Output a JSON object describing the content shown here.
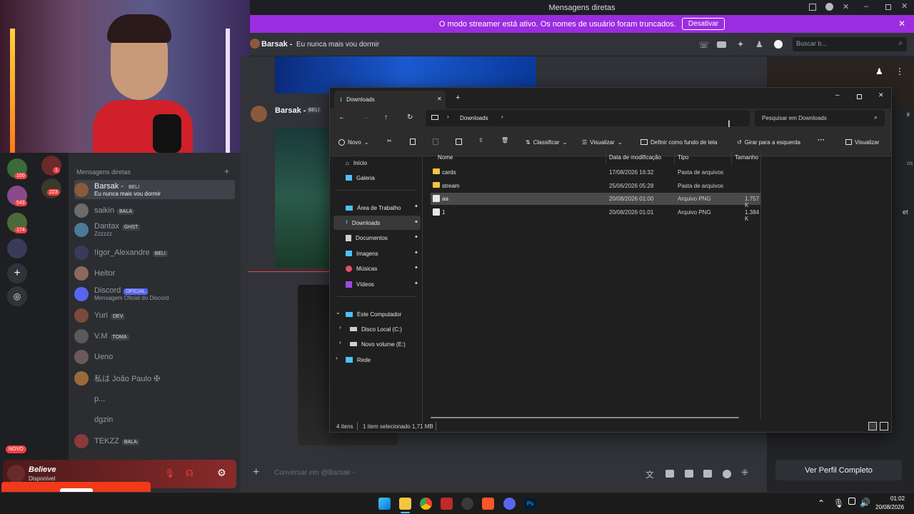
{
  "window": {
    "title": "Mensagens diretas"
  },
  "banner": {
    "text": "O modo streamer está ativo. Os nomes de usuário foram truncados.",
    "button": "Desativar"
  },
  "chat_header": {
    "name": "Barsak -",
    "status": "Eu nunca mais vou dormir",
    "search_placeholder": "Buscar b..."
  },
  "message": {
    "author": "Barsak -",
    "tag": "BELI"
  },
  "composer": {
    "placeholder": "Conversar em @Barsak -"
  },
  "profile": {
    "button": "Ver Perfil Completo",
    "partial_1": "ir",
    "partial_2": "os",
    "partial_3": "et"
  },
  "dm_list": {
    "header": "Mensagens diretas",
    "items": [
      {
        "name": "Barsak -",
        "tag": "BELI",
        "sub": "Eu nunca mais vou dormir",
        "color": "#8a5a3a"
      },
      {
        "name": "saikin",
        "tag": "BALA",
        "sub": "",
        "color": "#6b6b6b"
      },
      {
        "name": "Dantax",
        "tag": "GHST",
        "sub": "Zzzzzz",
        "color": "#4a7a9a"
      },
      {
        "name": "!Igor_Alexandre",
        "tag": "BELI",
        "sub": "",
        "color": "#3a3a5a"
      },
      {
        "name": "Heitor",
        "tag": "",
        "sub": "",
        "color": "#8a6a5a"
      },
      {
        "name": "Discord",
        "tag": "OFICIAL",
        "sub": "Mensagem Oficial do Discord",
        "color": "#5865f2"
      },
      {
        "name": "Yuri",
        "tag": "DEV",
        "sub": "",
        "color": "#7a4a3a"
      },
      {
        "name": "V.M",
        "tag": "TOMA",
        "sub": "",
        "color": "#5a5a5a"
      },
      {
        "name": "Ueno",
        "tag": "",
        "sub": "",
        "color": "#6a5a5a"
      },
      {
        "name": "私は João Paulo ✠",
        "tag": "",
        "sub": "",
        "color": "#9a6a3a"
      },
      {
        "name": "p...",
        "tag": "",
        "sub": "",
        "color": "#2b2d31"
      },
      {
        "name": "dgzin",
        "tag": "",
        "sub": "",
        "color": "#2b2d31"
      },
      {
        "name": "TEKZZ",
        "tag": "BALA",
        "sub": "",
        "color": "#8a3a3a"
      }
    ]
  },
  "servers": {
    "badges": [
      "100",
      "543",
      "174",
      "1",
      "223"
    ],
    "novo": "NOVO"
  },
  "user_panel": {
    "name": "Believe",
    "status": "Disponível"
  },
  "explorer": {
    "tab_title": "Downloads",
    "breadcrumb": "Downloads",
    "search_placeholder": "Pesquisar em Downloads",
    "toolbar": {
      "new": "Novo",
      "sort": "Classificar",
      "view": "Visualizar",
      "set_wallpaper": "Definir como fundo de tela",
      "rotate": "Girar para a esquerda",
      "more": "···",
      "preview": "Visualizar"
    },
    "nav": [
      "Início",
      "Galeria",
      "Área de Trabalho",
      "Downloads",
      "Documentos",
      "Imagens",
      "Músicas",
      "Vídeos",
      "Este Computador",
      "Disco Local (C:)",
      "Novo volume (E:)",
      "Rede"
    ],
    "columns": [
      "Nome",
      "Data de modificação",
      "Tipo",
      "Tamanho"
    ],
    "files": [
      {
        "name": "cards",
        "date": "17/08/2026 16:32",
        "type": "Pasta de arquivos",
        "size": "",
        "kind": "folder",
        "selected": false
      },
      {
        "name": "stream",
        "date": "25/06/2026 05:28",
        "type": "Pasta de arquivos",
        "size": "",
        "kind": "folder",
        "selected": false
      },
      {
        "name": "aa",
        "date": "20/08/2026 01:00",
        "type": "Arquivo PNG",
        "size": "1.757 K",
        "kind": "png",
        "selected": true
      },
      {
        "name": "1",
        "date": "20/08/2026 01:01",
        "type": "Arquivo PNG",
        "size": "1.384 K",
        "kind": "png",
        "selected": false
      }
    ],
    "status": {
      "count": "4 itens",
      "selected": "1 item selecionado 1,71 MB"
    }
  },
  "taskbar": {
    "time": "01:02",
    "date": "20/08/2026"
  }
}
